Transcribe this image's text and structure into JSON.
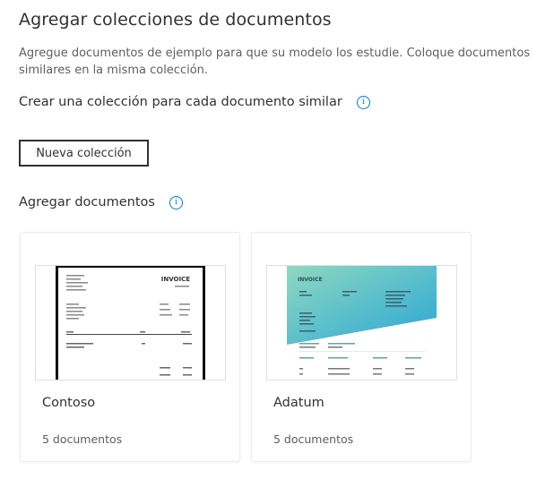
{
  "page": {
    "title": "Agregar colecciones de documentos",
    "description": "Agregue documentos de ejemplo para que su modelo los estudie. Coloque documentos similares en la misma colección."
  },
  "collection_section": {
    "heading": "Crear una colección para cada documento similar",
    "info_icon": "info-icon",
    "new_button_label": "Nueva colección"
  },
  "documents_section": {
    "heading": "Agregar documentos",
    "info_icon": "info-icon",
    "cards": [
      {
        "name": "Contoso",
        "count": "5 documentos",
        "thumbnail_heading": "INVOICE"
      },
      {
        "name": "Adatum",
        "count": "5 documentos",
        "thumbnail_heading": "INVOICE"
      }
    ]
  },
  "colors": {
    "accent": "#0078d4",
    "text": "#323130",
    "muted_text": "#605e5c",
    "card_border": "#edebe9",
    "adatum_gradient_start": "#7fd3c3",
    "adatum_gradient_end": "#2aa6d6"
  }
}
